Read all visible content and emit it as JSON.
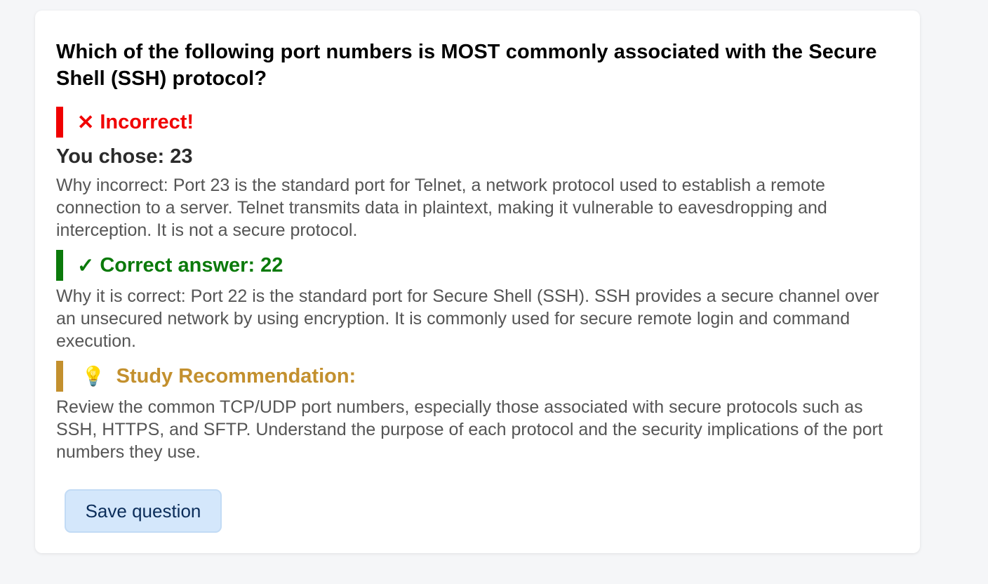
{
  "question": {
    "text": "Which of the following port numbers is MOST commonly associated with the Secure Shell (SSH) protocol?"
  },
  "result": {
    "icon": "cross-icon",
    "icon_glyph": "✕",
    "label": "Incorrect!",
    "color": "#f00000"
  },
  "chosen": {
    "text": "You chose: 23"
  },
  "incorrect_explanation": {
    "text": "Why incorrect: Port 23 is the standard port for Telnet, a network protocol used to establish a remote connection to a server. Telnet transmits data in plaintext, making it vulnerable to eavesdropping and interception. It is not a secure protocol."
  },
  "correct": {
    "icon": "checkmark-icon",
    "icon_glyph": "✓",
    "label": "Correct answer: 22",
    "color": "#0b7a0b"
  },
  "correct_explanation": {
    "text": "Why it is correct: Port 22 is the standard port for Secure Shell (SSH). SSH provides a secure channel over an unsecured network by using encryption. It is commonly used for secure remote login and command execution."
  },
  "study": {
    "icon": "lightbulb-icon",
    "icon_glyph": "💡",
    "label": "Study Recommendation:",
    "color": "#c3902e",
    "text": "Review the common TCP/UDP port numbers, especially those associated with secure protocols such as SSH, HTTPS, and SFTP. Understand the purpose of each protocol and the security implications of the port numbers they use."
  },
  "actions": {
    "save_label": "Save question"
  }
}
